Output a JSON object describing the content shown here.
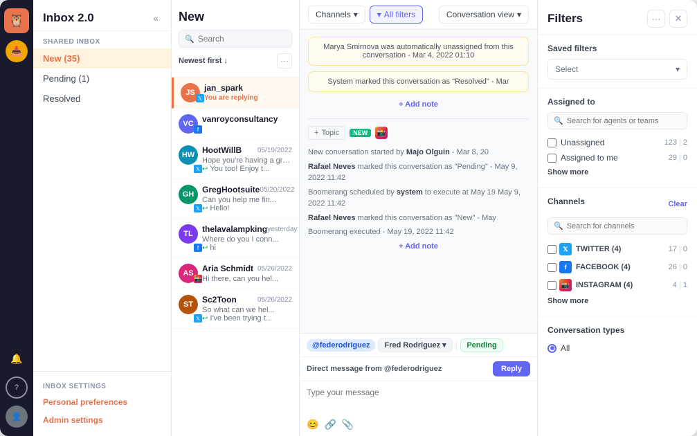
{
  "app": {
    "title": "Inbox 2.0",
    "logo": "🦉"
  },
  "left_sidebar": {
    "icons": [
      {
        "name": "inbox-icon",
        "symbol": "📥",
        "active": true
      },
      {
        "name": "bell-icon",
        "symbol": "🔔"
      },
      {
        "name": "help-icon",
        "symbol": "?"
      },
      {
        "name": "user-avatar",
        "symbol": "👤"
      }
    ]
  },
  "nav_panel": {
    "section_label": "Shared Inbox",
    "title": "Inbox 2.0",
    "items": [
      {
        "label": "New (35)",
        "active": true
      },
      {
        "label": "Pending (1)",
        "active": false
      },
      {
        "label": "Resolved",
        "active": false
      }
    ],
    "footer_label": "Inbox Settings",
    "footer_links": [
      "Personal preferences",
      "Admin settings"
    ]
  },
  "conv_list": {
    "page_title": "New",
    "search_placeholder": "Search",
    "sort_label": "Newest first",
    "conversations": [
      {
        "name": "jan_spark",
        "preview": "You are replying",
        "time": "",
        "active": true,
        "color": "#e8734a",
        "initials": "JS",
        "channel": "twitter"
      },
      {
        "name": "vanroyconsultancy",
        "preview": "",
        "time": "",
        "active": false,
        "color": "#6366f1",
        "initials": "VC",
        "channel": "facebook"
      },
      {
        "name": "HootWillB",
        "preview": "Hope you're having a great day...",
        "preview2": "You too! Enjoy t...",
        "time": "05/19/2022",
        "active": false,
        "color": "#0891b2",
        "initials": "HW",
        "channel": "twitter"
      },
      {
        "name": "GregHootsuite",
        "preview": "Can you help me fin...",
        "preview2": "Hello!",
        "time": "05/20/2022",
        "active": false,
        "color": "#059669",
        "initials": "GH",
        "channel": "twitter"
      },
      {
        "name": "thelavalampking",
        "preview": "Where do you I conn...",
        "preview2": "hi",
        "time": "yesterday",
        "active": false,
        "color": "#7c3aed",
        "initials": "TL",
        "channel": "facebook"
      },
      {
        "name": "Aria Schmidt",
        "preview": "Hi there, can you hel...",
        "preview2": "",
        "time": "05/26/2022",
        "active": false,
        "color": "#db2777",
        "initials": "AS",
        "channel": "instagram"
      },
      {
        "name": "Sc2Toon",
        "preview": "So what can we hel...",
        "preview2": "I've been trying t...",
        "time": "05/26/2022",
        "active": false,
        "color": "#b45309",
        "initials": "ST",
        "channel": "twitter"
      }
    ]
  },
  "conv_main": {
    "toolbar": {
      "channels_label": "Channels",
      "filters_label": "All filters",
      "view_label": "Conversation view"
    },
    "messages": [
      {
        "text": "Marya Smirnova was automatically unassigned from this conversation - Mar 4, 2022 01:10",
        "type": "event"
      },
      {
        "text": "System marked this conversation as \"Resolved\" - Mar",
        "type": "event"
      }
    ],
    "add_note_1": "+ Add note",
    "topic_badge": "Topic",
    "new_badge": "NEW",
    "events": [
      "New conversation started by Majo Olguin - Mar 8, 20",
      "Rafael Neves marked this conversation as \"Pending\" - May 9, 2022 11:42",
      "Boomerang scheduled by system to execute at May 19 May 9, 2022 11:42",
      "Rafael Neves marked this conversation as \"New\" - May",
      "Boomerang executed - May 19, 2022 11:42"
    ],
    "add_note_2": "+ Add note",
    "reply": {
      "user_tag": "@federodriguez",
      "agent_tag": "Fred Rodriguez",
      "status_tag": "Pending",
      "source_label": "Direct message from @federodriguez",
      "reply_btn": "Reply",
      "placeholder": "Type your message"
    }
  },
  "filters": {
    "title": "Filters",
    "saved_filters": {
      "label": "Saved filters",
      "placeholder": "Select"
    },
    "assigned_to": {
      "label": "Assigned to",
      "search_placeholder": "Search for agents or teams",
      "options": [
        {
          "label": "Unassigned",
          "count": "123",
          "extra": "2"
        },
        {
          "label": "Assigned to me",
          "count": "29",
          "extra": "0"
        }
      ],
      "show_more": "Show more"
    },
    "channels": {
      "label": "Channels",
      "clear": "Clear",
      "search_placeholder": "Search for channels",
      "items": [
        {
          "label": "TWITTER (4)",
          "count": "17",
          "extra": "0",
          "color": "#1da1f2"
        },
        {
          "label": "FACEBOOK (4)",
          "count": "26",
          "extra": "0",
          "color": "#1877f2"
        },
        {
          "label": "INSTAGRAM (4)",
          "count": "4",
          "extra": "1",
          "color": "#e1306c"
        }
      ],
      "show_more": "Show more"
    },
    "conv_types": {
      "label": "Conversation types",
      "options": [
        "All"
      ]
    }
  }
}
